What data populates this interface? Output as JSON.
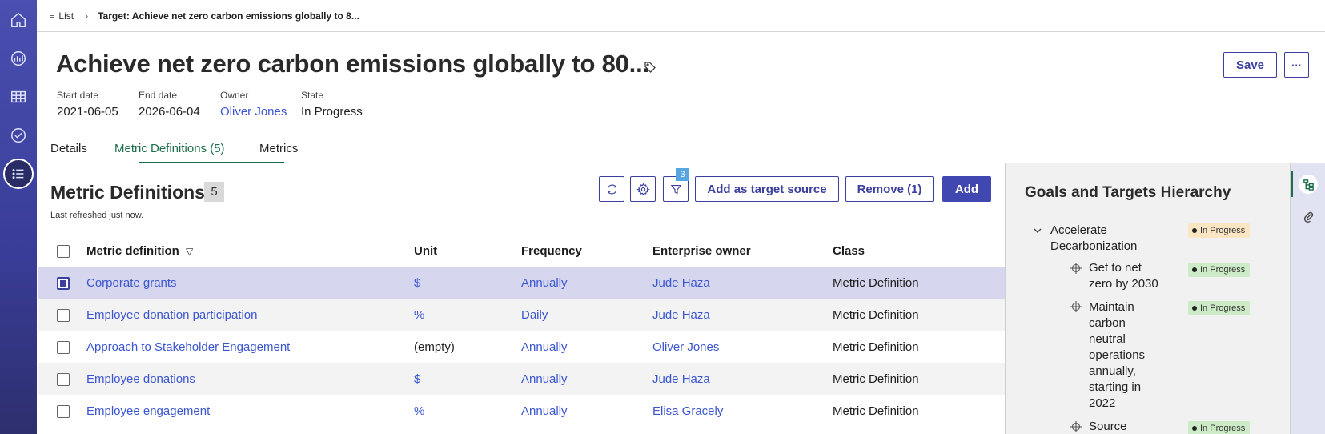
{
  "breadcrumb": {
    "list_label": "List",
    "current": "Target: Achieve net zero carbon emissions globally to 8..."
  },
  "header": {
    "title": "Achieve net zero carbon emissions globally to 80...",
    "save_label": "Save",
    "more_label": "···",
    "fields": {
      "start_date": {
        "label": "Start date",
        "value": "2021-06-05"
      },
      "end_date": {
        "label": "End date",
        "value": "2026-06-04"
      },
      "owner": {
        "label": "Owner",
        "value": "Oliver Jones"
      },
      "state": {
        "label": "State",
        "value": "In Progress"
      }
    }
  },
  "tabs": [
    {
      "label": "Details"
    },
    {
      "label": "Metric Definitions (5)"
    },
    {
      "label": "Metrics"
    }
  ],
  "list": {
    "title": "Metric Definitions",
    "count": "5",
    "refreshed": "Last refreshed just now.",
    "filter_count": "3",
    "add_target_source_label": "Add as target source",
    "remove_label": "Remove (1)",
    "add_label": "Add",
    "columns": [
      "Metric definition",
      "Unit",
      "Frequency",
      "Enterprise owner",
      "Class"
    ],
    "rows": [
      {
        "definition": "Corporate grants",
        "unit": "$",
        "frequency": "Annually",
        "owner": "Jude Haza",
        "class": "Metric Definition",
        "selected": true
      },
      {
        "definition": "Employee donation participation",
        "unit": "%",
        "frequency": "Daily",
        "owner": "Jude Haza",
        "class": "Metric Definition",
        "selected": false
      },
      {
        "definition": "Approach to Stakeholder Engagement",
        "unit": "(empty)",
        "frequency": "Annually",
        "owner": "Oliver Jones",
        "class": "Metric Definition",
        "selected": false
      },
      {
        "definition": "Employee donations",
        "unit": "$",
        "frequency": "Annually",
        "owner": "Jude Haza",
        "class": "Metric Definition",
        "selected": false
      },
      {
        "definition": "Employee engagement",
        "unit": "%",
        "frequency": "Annually",
        "owner": "Elisa Gracely",
        "class": "Metric Definition",
        "selected": false
      }
    ]
  },
  "hierarchy": {
    "title": "Goals and Targets Hierarchy",
    "items": [
      {
        "label": "Accelerate Decarbonization",
        "status": "In Progress"
      },
      {
        "label": "Get to net zero by 2030",
        "status": "In Progress"
      },
      {
        "label": "Maintain carbon neutral operations annually, starting in 2022",
        "status": "In Progress"
      },
      {
        "label": "Source",
        "status": "In Progress"
      }
    ]
  },
  "colors": {
    "nav_bg": "#3a3e9a",
    "accent": "#3b3f9e",
    "link": "#3b56d0",
    "active_tab": "#1d6e4a",
    "selected_row": "#d6d7ef",
    "status_amber": "#fbe6c4",
    "status_green": "#cdebc6"
  }
}
